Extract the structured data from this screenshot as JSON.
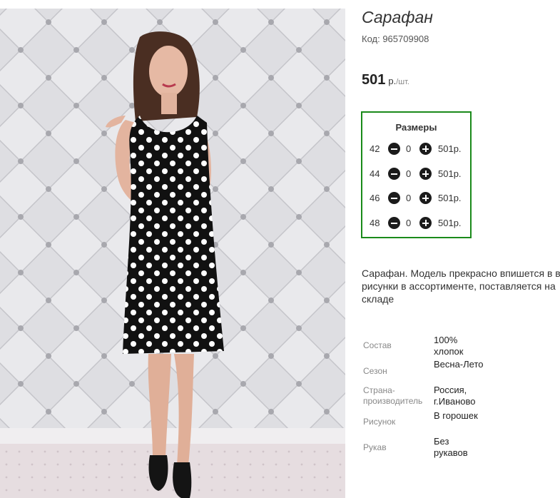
{
  "product": {
    "title": "Сарафан",
    "code": "Код: 965709908",
    "price": "501",
    "price_unit_main": "р.",
    "price_unit_sub": "/шт."
  },
  "sizes": {
    "title": "Размеры",
    "rows": [
      {
        "size": "42",
        "qty": "0",
        "price": "501р."
      },
      {
        "size": "44",
        "qty": "0",
        "price": "501р."
      },
      {
        "size": "46",
        "qty": "0",
        "price": "501р."
      },
      {
        "size": "48",
        "qty": "0",
        "price": "501р."
      }
    ]
  },
  "description": {
    "line1": "Сарафан. Модель прекрасно впишется в в",
    "line2": "рисунки в ассортименте, поставляется на",
    "line3": "складе"
  },
  "properties": [
    {
      "key": "Состав",
      "value": "100% хлопок"
    },
    {
      "key": "Сезон",
      "value": "Весна-Лето"
    },
    {
      "key": "Страна-производитель",
      "value": "Россия, г.Иваново"
    },
    {
      "key": "Рисунок",
      "value": "В горошек"
    },
    {
      "key": "Рукав",
      "value": "Без рукавов"
    }
  ],
  "colors": {
    "accent_border": "#1a8a1a",
    "button": "#1b1b1b",
    "dress": "#111111",
    "dots": "#ffffff"
  }
}
